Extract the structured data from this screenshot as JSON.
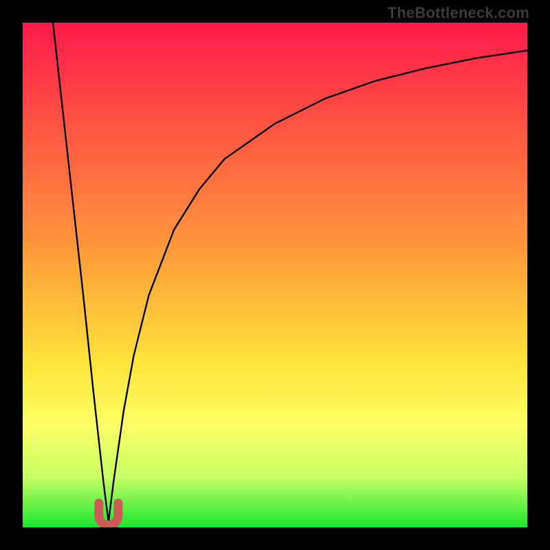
{
  "watermark": {
    "text": "TheBottleneck.com"
  },
  "chart_data": {
    "type": "line",
    "title": "",
    "xlabel": "",
    "ylabel": "",
    "xlim": [
      0,
      100
    ],
    "ylim": [
      0,
      100
    ],
    "x_minimum": 17,
    "gradient_stops": [
      {
        "offset": 0,
        "color": "#ff1a4b"
      },
      {
        "offset": 45,
        "color": "#ff993a"
      },
      {
        "offset": 68,
        "color": "#ffe63a"
      },
      {
        "offset": 80,
        "color": "#fbff66"
      },
      {
        "offset": 90,
        "color": "#c8ff66"
      },
      {
        "offset": 100,
        "color": "#19e62e"
      }
    ],
    "series": [
      {
        "name": "left-branch",
        "x": [
          6,
          8,
          10,
          12,
          14,
          15,
          16,
          17
        ],
        "y": [
          100,
          82,
          64,
          46,
          27,
          18,
          9,
          1
        ]
      },
      {
        "name": "right-branch",
        "x": [
          17,
          18,
          20,
          22,
          25,
          30,
          35,
          40,
          50,
          60,
          70,
          80,
          90,
          100
        ],
        "y": [
          1,
          9,
          23,
          34,
          46,
          59,
          67,
          73,
          80,
          85,
          88.5,
          91,
          93,
          94.5
        ]
      }
    ],
    "marker": {
      "shape": "u",
      "center_x": 17,
      "base_y": 1,
      "color": "#cc5a57"
    }
  }
}
